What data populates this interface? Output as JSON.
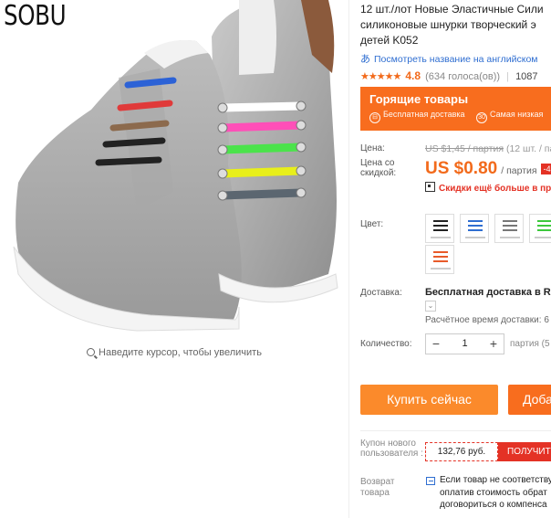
{
  "brand": "SOBU",
  "zoom_hint": "Наведите курсор, чтобы увеличить",
  "product": {
    "title_line1": "12 шт./лот Новые Эластичные Сили",
    "title_line2": "силиконовые шнурки творческий э",
    "title_line3": "детей K052",
    "translate_link": "Посмотреть название на английском",
    "stars": "★★★★★",
    "rating": "4.8",
    "votes": "(634 голоса(ов))",
    "orders": "1087"
  },
  "promo": {
    "title": "Горящие товары",
    "feature1": "Бесплатная доставка",
    "feature2_icon_text": "30",
    "feature2": "Самая низкая"
  },
  "price": {
    "label": "Цена:",
    "old": "US $1,45 / партия",
    "old_extra": "(12 шт. / па",
    "discount_label": "Цена со скидкой:",
    "new": "US $0.80",
    "unit": "/ партия",
    "badge": "-4",
    "coupon_link": "Скидки ещё больше в при"
  },
  "color": {
    "label": "Цвет:",
    "options": [
      {
        "name": "black-color-option",
        "lace": "#222222"
      },
      {
        "name": "blue-color-option",
        "lace": "#2f6ed1"
      },
      {
        "name": "gray-color-option",
        "lace": "#777777"
      },
      {
        "name": "green-color-option",
        "lace": "#3cc83c"
      },
      {
        "name": "orange-color-option",
        "lace": "#e85b2a"
      }
    ]
  },
  "shipping": {
    "label": "Доставка:",
    "value": "Бесплатная доставка в Russ",
    "chevron": "⌄",
    "time": "Расчётное время доставки: 6"
  },
  "quantity": {
    "label": "Количество:",
    "minus": "−",
    "value": "1",
    "plus": "+",
    "available": "партия (5"
  },
  "actions": {
    "buy_now": "Купить сейчас",
    "add_to_cart": "Доба"
  },
  "coupon": {
    "label": "Купон нового пользователя :",
    "amount": "132,76 руб.",
    "get": "ПОЛУЧИТЬ"
  },
  "returns": {
    "label": "Возврат товара",
    "line1": "Если товар не соответству",
    "line2": "оплатив стоимость обрат",
    "line3": "договориться о компенса"
  },
  "colors": {
    "accent": "#f86d1e",
    "price": "#f26a1b",
    "red": "#e43225",
    "link": "#2f6ed1"
  }
}
